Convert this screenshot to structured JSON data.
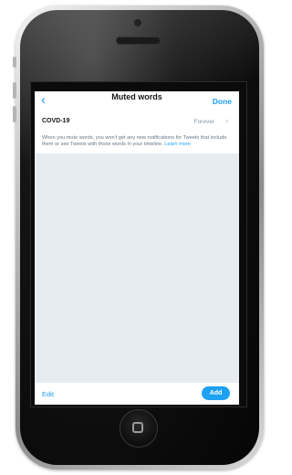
{
  "navbar": {
    "back_icon": "chevron-left-icon",
    "title": "Muted words",
    "done_label": "Done"
  },
  "muted_word": {
    "word": "COVD-19",
    "duration": "Forever",
    "chevron_icon": "chevron-right-icon"
  },
  "description": {
    "text": "When you mute words, you won't get any new notifications for Tweets that include them or see Tweets with those words in your timeline.",
    "link_label": "Learn more"
  },
  "bottom_bar": {
    "edit_label": "Edit",
    "add_label": "Add"
  },
  "colors": {
    "accent": "#1da1f2",
    "background": "#e6ecf0",
    "text": "#14171a",
    "secondary_text": "#657786"
  }
}
